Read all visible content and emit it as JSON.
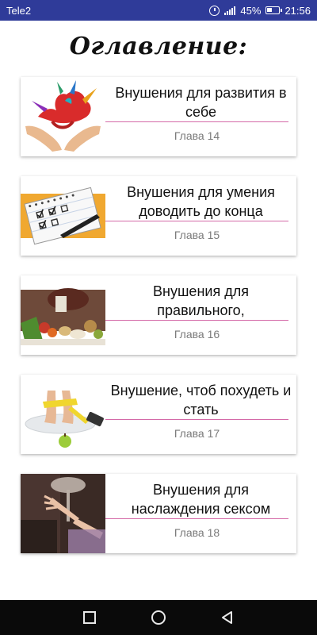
{
  "status_bar": {
    "carrier": "Tele2",
    "battery": "45%",
    "time": "21:56"
  },
  "header": {
    "title": "Оглавление:"
  },
  "chapters": [
    {
      "title": "Внушения для развития в себе",
      "chapter": "Глава 14",
      "image": "hands-paint-splash"
    },
    {
      "title": "Внушения для умения доводить до конца",
      "chapter": "Глава 15",
      "image": "checklist-notebook"
    },
    {
      "title": "Внушения для правильного,",
      "chapter": "Глава 16",
      "image": "healthy-food"
    },
    {
      "title": "Внушение, чтоб похудеть и стать",
      "chapter": "Глава 17",
      "image": "scale-measuring-tape"
    },
    {
      "title": "Внушения для наслаждения сексом",
      "chapter": "Глава 18",
      "image": "hand-on-lamp-bedroom"
    }
  ],
  "nav_bar": {
    "icons": [
      "recent-apps-icon",
      "home-icon",
      "back-icon"
    ]
  },
  "colors": {
    "status_bar": "#2f3b99",
    "divider": "#d46aa8",
    "nav_bar": "#0a0a0a"
  }
}
